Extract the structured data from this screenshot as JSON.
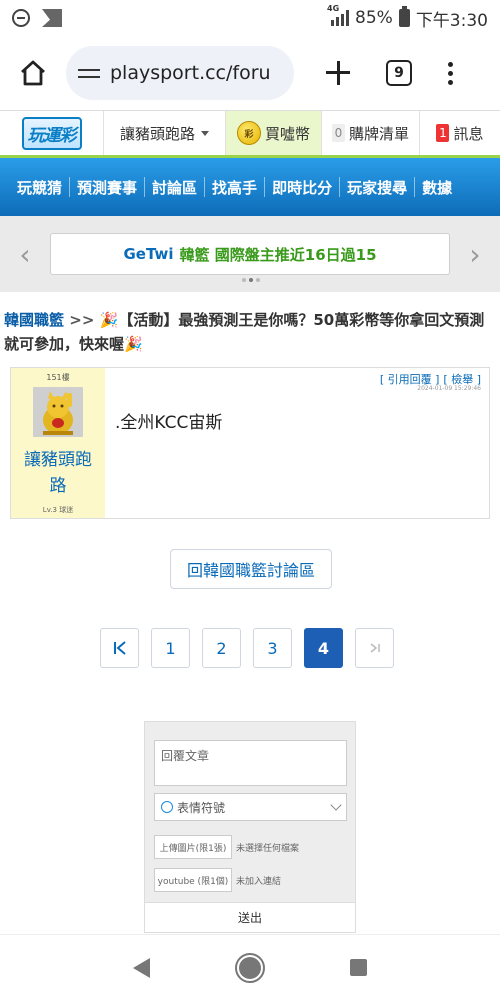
{
  "status_bar": {
    "network": "4G",
    "battery": "85%",
    "time": "下午3:30"
  },
  "browser": {
    "url": "playsport.cc/foru",
    "tab_count": "9"
  },
  "site_header": {
    "logo": "玩運彩",
    "username": "讓豬頭跑路",
    "coins_icon_text": "彩",
    "coins_label": "買噓幣",
    "cart_count": "0",
    "cart_label": "購牌清單",
    "messages_count": "1",
    "messages_label": "訊息"
  },
  "nav": {
    "items": [
      "玩競猜",
      "預測賽事",
      "討論區",
      "找高手",
      "即時比分",
      "玩家搜尋",
      "數據"
    ]
  },
  "carousel": {
    "prev": "‹",
    "next": "›",
    "author": "GeTwi",
    "text": "韓籃 國際盤主推近16日過15"
  },
  "thread": {
    "board": "韓國職籃",
    "arrow": ">>",
    "emoji_prefix": "🎉",
    "title": "【活動】最強預測王是你嗎？50萬彩幣等你拿回文預測就可參加，快來喔",
    "emoji_suffix": "🎉"
  },
  "post": {
    "floor": "151樓",
    "username": "讓豬頭跑路",
    "level": "Lv.3 球迷",
    "action_quote": "[ 引用回覆 ]",
    "action_report": "[ 檢舉 ]",
    "timestamp": "2024-01-09 15:29:46",
    "content": ".全州KCC宙斯"
  },
  "back_button": "回韓國職籃討論區",
  "pagination": {
    "first": "|<",
    "pages": [
      "1",
      "2",
      "3",
      "4"
    ],
    "current": "4",
    "last": ">|"
  },
  "reply_form": {
    "text_placeholder": "回覆文章",
    "emoji_label": "表情符號",
    "upload_image_label": "上傳圖片(限1張)",
    "upload_image_status": "未選擇任何檔案",
    "youtube_label": "youtube (限1個)",
    "youtube_status": "未加入連結",
    "send_label": "送出"
  }
}
